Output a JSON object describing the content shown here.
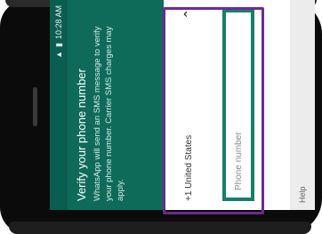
{
  "status": {
    "time": "10:28 AM"
  },
  "header": {
    "title": "Verify your phone number",
    "description": "WhatsApp will send an SMS message to verify your phone number. Carrier SMS charges may apply."
  },
  "country": {
    "label": "+1 United States"
  },
  "phone_input": {
    "placeholder": "Phone number"
  },
  "help": {
    "label": "Help"
  },
  "colors": {
    "header": "#0f6b59",
    "input_border": "#13806b",
    "highlight": "#6d2a92"
  }
}
